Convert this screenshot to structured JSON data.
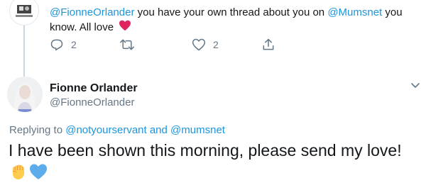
{
  "reply_tweet": {
    "text_parts": [
      "@FionneOrlander",
      " you have your own thread about you on ",
      "@Mumsnet",
      " you know. All love"
    ],
    "reply_count": "2",
    "like_count": "2"
  },
  "main_tweet": {
    "display_name": "Fionne Orlander",
    "handle": "@FionneOrlander",
    "replying_prefix": "Replying to ",
    "replying_to_1": "@notyourservant",
    "replying_and": " and ",
    "replying_to_2": "@mumsnet",
    "text": "I have been shown this morning, please send my love!",
    "emojis": [
      "raised-fist-emoji",
      "blue-heart-emoji"
    ]
  },
  "icons": {
    "reply": "reply-icon",
    "retweet": "retweet-icon",
    "like": "heart-outline-icon",
    "share": "share-icon",
    "chevron": "chevron-down-icon"
  },
  "colors": {
    "link": "#1b95e0",
    "secondary": "#657786",
    "primary_text": "#14171a",
    "heart_red": "#e0245e",
    "fist_yellow": "#ffcc4d",
    "blue_heart": "#5dadec"
  }
}
